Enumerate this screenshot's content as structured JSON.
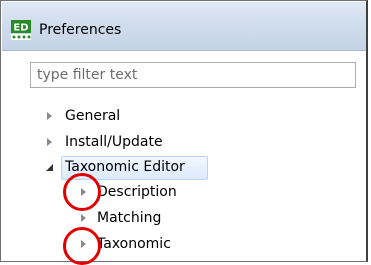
{
  "window": {
    "title": "Preferences",
    "icon": "ed-app-icon"
  },
  "filter": {
    "placeholder": "type filter text",
    "value": ""
  },
  "tree": [
    {
      "label": "General",
      "state": "collapsed"
    },
    {
      "label": "Install/Update",
      "state": "collapsed"
    },
    {
      "label": "Taxonomic Editor",
      "state": "expanded",
      "selected": true
    },
    {
      "label": "Description",
      "state": "collapsed"
    },
    {
      "label": "Matching",
      "state": "collapsed"
    },
    {
      "label": "Taxonomic",
      "state": "collapsed"
    }
  ],
  "annotations": {
    "highlight_color": "#e00000",
    "circled_items": [
      "description-expander",
      "taxonomic-expander"
    ]
  },
  "colors": {
    "titlebar": "#cfdcec",
    "selection": "#dbeafd"
  }
}
